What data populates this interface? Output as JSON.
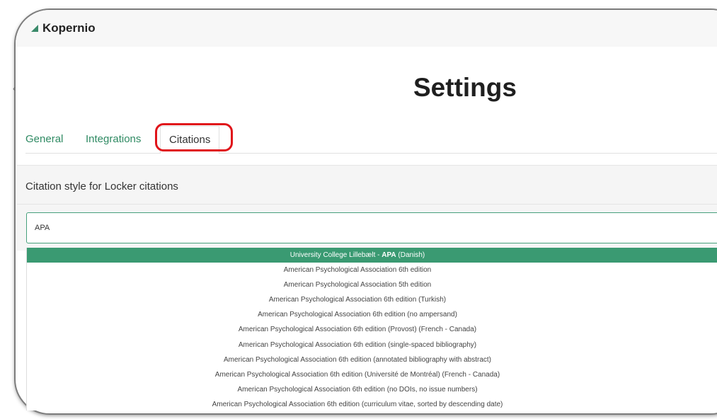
{
  "app": {
    "brand": "Kopernio",
    "side_mark": "‹"
  },
  "page": {
    "title": "Settings"
  },
  "tabs": [
    {
      "label": "General",
      "active": false
    },
    {
      "label": "Integrations",
      "active": false
    },
    {
      "label": "Citations",
      "active": true
    }
  ],
  "citation_panel": {
    "label": "Citation style for Locker citations",
    "search_value": "APA"
  },
  "dropdown": {
    "options": [
      {
        "prefix": "University College Lillebælt - ",
        "bold": "APA",
        "suffix": " (Danish)",
        "selected": true
      },
      {
        "prefix": "American Psychological Association 6th edition",
        "bold": "",
        "suffix": "",
        "selected": false
      },
      {
        "prefix": "American Psychological Association 5th edition",
        "bold": "",
        "suffix": "",
        "selected": false
      },
      {
        "prefix": "American Psychological Association 6th edition (Turkish)",
        "bold": "",
        "suffix": "",
        "selected": false
      },
      {
        "prefix": "American Psychological Association 6th edition (no ampersand)",
        "bold": "",
        "suffix": "",
        "selected": false
      },
      {
        "prefix": "American Psychological Association 6th edition (Provost) (French - Canada)",
        "bold": "",
        "suffix": "",
        "selected": false
      },
      {
        "prefix": "American Psychological Association 6th edition (single-spaced bibliography)",
        "bold": "",
        "suffix": "",
        "selected": false
      },
      {
        "prefix": "American Psychological Association 6th edition (annotated bibliography with abstract)",
        "bold": "",
        "suffix": "",
        "selected": false
      },
      {
        "prefix": "American Psychological Association 6th edition (Université de Montréal) (French - Canada)",
        "bold": "",
        "suffix": "",
        "selected": false
      },
      {
        "prefix": "American Psychological Association 6th edition (no DOIs, no issue numbers)",
        "bold": "",
        "suffix": "",
        "selected": false
      },
      {
        "prefix": "American Psychological Association 6th edition (curriculum vitae, sorted by descending date)",
        "bold": "",
        "suffix": "",
        "selected": false
      }
    ]
  },
  "colors": {
    "accent": "#3a9a72",
    "tab_link": "#2f8a63",
    "highlight_ring": "#e0141a"
  }
}
